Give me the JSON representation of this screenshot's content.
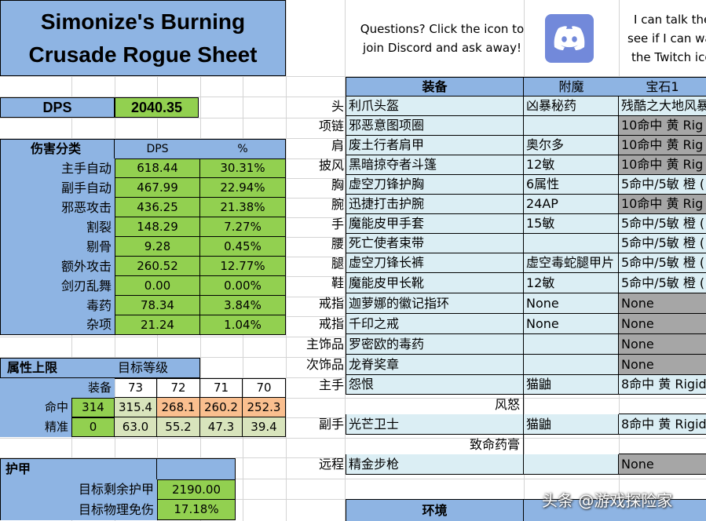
{
  "title": [
    "Simonize's Burning",
    "Crusade Rogue Sheet"
  ],
  "discord_note": [
    "Questions? Click the icon to",
    "join Discord and ask away!"
  ],
  "twitch_note": [
    "I can talk the",
    "see if I can wa",
    "the Twitch ico"
  ],
  "dps": {
    "label": "DPS",
    "value": "2040.35"
  },
  "breakdown": {
    "header": "伤害分类",
    "col_dps": "DPS",
    "col_pct": "%",
    "rows": [
      {
        "name": "主手自动",
        "dps": "618.44",
        "pct": "30.31%"
      },
      {
        "name": "副手自动",
        "dps": "467.99",
        "pct": "22.94%"
      },
      {
        "name": "邪恶攻击",
        "dps": "436.25",
        "pct": "21.38%"
      },
      {
        "name": "割裂",
        "dps": "148.29",
        "pct": "7.27%"
      },
      {
        "name": "剔骨",
        "dps": "9.28",
        "pct": "0.45%"
      },
      {
        "name": "额外攻击",
        "dps": "260.52",
        "pct": "12.77%"
      },
      {
        "name": "剑刃乱舞",
        "dps": "0.00",
        "pct": "0.00%"
      },
      {
        "name": "毒药",
        "dps": "78.34",
        "pct": "3.84%"
      },
      {
        "name": "杂项",
        "dps": "21.24",
        "pct": "1.04%"
      }
    ]
  },
  "caps": {
    "header": "属性上限",
    "target_level": "目标等级",
    "gear": "装备",
    "levels": [
      "73",
      "72",
      "71",
      "70"
    ],
    "hit": {
      "label": "命中",
      "gear": "314",
      "vals": [
        "315.4",
        "268.1",
        "260.2",
        "252.3"
      ]
    },
    "exp": {
      "label": "精准",
      "gear": "0",
      "vals": [
        "63.0",
        "55.2",
        "47.3",
        "39.4"
      ]
    }
  },
  "armor": {
    "header": "护甲",
    "rows": [
      {
        "label": "目标剩余护甲",
        "value": "2190.00"
      },
      {
        "label": "目标物理免伤",
        "value": "17.18%"
      }
    ]
  },
  "gear": {
    "headers": {
      "item": "装备",
      "enchant": "附魔",
      "gem": "宝石1"
    },
    "rows": [
      {
        "slot": "头",
        "item": "利爪头盔",
        "enchant": "凶暴秘药",
        "gem": "残酷之大地风暴",
        "gem_gray": false
      },
      {
        "slot": "项链",
        "item": "邪恶意图项圈",
        "enchant": "",
        "gem": "10命中 黄 Rig",
        "gem_gray": true
      },
      {
        "slot": "肩",
        "item": "废土行者肩甲",
        "enchant": "奥尔多",
        "gem": "10命中 黄 Rig",
        "gem_gray": true
      },
      {
        "slot": "披风",
        "item": "黑暗掠夺者斗篷",
        "enchant": "12敏",
        "gem": "10命中 黄 Rig",
        "gem_gray": true
      },
      {
        "slot": "胸",
        "item": "虚空刀锋护胸",
        "enchant": "6属性",
        "gem": "5命中/5敏 橙 (",
        "gem_gray": false
      },
      {
        "slot": "腕",
        "item": "迅捷打击护腕",
        "enchant": "24AP",
        "gem": "10命中 黄 Rig",
        "gem_gray": true
      },
      {
        "slot": "手",
        "item": "魔能皮甲手套",
        "enchant": "15敏",
        "gem": "5命中/5敏 橙 (",
        "gem_gray": false
      },
      {
        "slot": "腰",
        "item": "死亡使者束带",
        "enchant": "",
        "gem": "5命中/5敏 橙 (",
        "gem_gray": false
      },
      {
        "slot": "腿",
        "item": "虚空刀锋长裤",
        "enchant": "虚空毒蛇腿甲片",
        "gem": "5命中/5敏 橙 (",
        "gem_gray": false
      },
      {
        "slot": "鞋",
        "item": "魔能皮甲长靴",
        "enchant": "12敏",
        "gem": "5命中/5敏 橙 (",
        "gem_gray": false
      },
      {
        "slot": "戒指",
        "item": "迦萝娜的徽记指环",
        "enchant": "None",
        "gem": "None",
        "gem_gray": true
      },
      {
        "slot": "戒指",
        "item": "千印之戒",
        "enchant": "None",
        "gem": "None",
        "gem_gray": true
      },
      {
        "slot": "主饰品",
        "item": "罗密欧的毒药",
        "enchant": "",
        "gem": "None",
        "gem_gray": true
      },
      {
        "slot": "次饰品",
        "item": "龙脊奖章",
        "enchant": "",
        "gem": "None",
        "gem_gray": true
      },
      {
        "slot": "主手",
        "item": "怨恨",
        "enchant": "猫鼬",
        "gem": "8命中 黄 Rigid",
        "gem_gray": false
      },
      {
        "slot": "",
        "item": "风怒",
        "enchant": "",
        "gem": "",
        "gem_gray": false,
        "sub": true
      },
      {
        "slot": "副手",
        "item": "光芒卫士",
        "enchant": "猫鼬",
        "gem": "8命中 黄 Rigid",
        "gem_gray": false
      },
      {
        "slot": "",
        "item": "致命药膏",
        "enchant": "",
        "gem": "",
        "gem_gray": false,
        "sub": true
      },
      {
        "slot": "远程",
        "item": "精金步枪",
        "enchant": "",
        "gem": "None",
        "gem_gray": true
      }
    ]
  },
  "env_label": "环境",
  "watermark": "头条 @游戏探险家",
  "colors": {
    "header_blue": "#8eb4e3",
    "value_green": "#92d050",
    "cell_light_blue": "#dbeef4",
    "cell_gray": "#a6a6a6",
    "discord": "#7289da"
  },
  "icons": {
    "discord": "discord-icon"
  }
}
